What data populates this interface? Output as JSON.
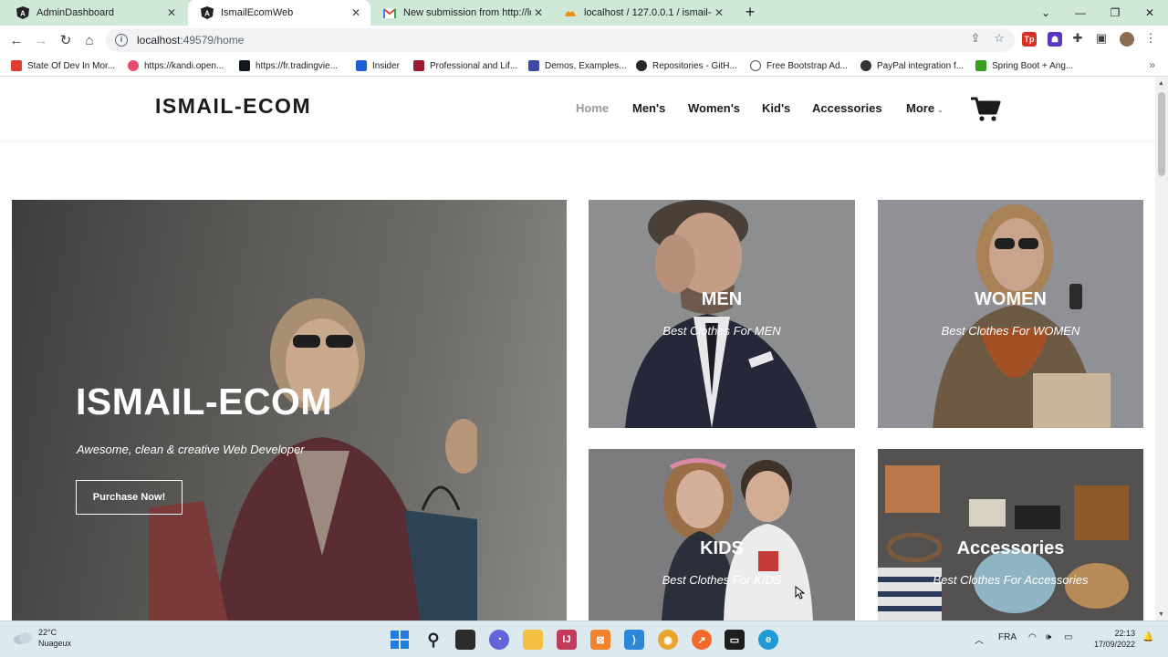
{
  "browser": {
    "tabs": [
      {
        "title": "AdminDashboard",
        "icon": "angular-icon",
        "active": false
      },
      {
        "title": "IsmailEcomWeb",
        "icon": "angular-icon",
        "active": true
      },
      {
        "title": "New submission from http://localhost",
        "icon": "gmail-icon",
        "active": false
      },
      {
        "title": "localhost / 127.0.0.1 / ismail-ecom",
        "icon": "phpmyadmin-icon",
        "active": false
      }
    ],
    "url_host": "localhost",
    "url_path": ":49579/home",
    "bookmarks": [
      {
        "label": "State Of Dev In Mor...",
        "color": "#e03b2f"
      },
      {
        "label": "https://kandi.open...",
        "color": "#e84c6b"
      },
      {
        "label": "https://fr.tradingvie...",
        "color": "#131722"
      },
      {
        "label": "Insider",
        "color": "#1d5fd6"
      },
      {
        "label": "Professional and Lif...",
        "color": "#9b1c2e"
      },
      {
        "label": "Demos, Examples...",
        "color": "#3b4aa6"
      },
      {
        "label": "Repositories - GitH...",
        "color": "#24292f"
      },
      {
        "label": "Free Bootstrap Ad...",
        "color": "#555555"
      },
      {
        "label": "PayPal integration f...",
        "color": "#333333"
      },
      {
        "label": "Spring Boot + Ang...",
        "color": "#3a9d23"
      }
    ]
  },
  "site": {
    "brand": "ISMAIL-ECOM",
    "menu": [
      {
        "label": "Home",
        "active": true
      },
      {
        "label": "Men's",
        "active": false
      },
      {
        "label": "Women's",
        "active": false
      },
      {
        "label": "Kid's",
        "active": false
      },
      {
        "label": "Accessories",
        "active": false
      },
      {
        "label": "More",
        "active": false
      }
    ],
    "hero": {
      "title": "ISMAIL-ECOM",
      "subtitle": "Awesome, clean & creative Web Developer",
      "button": "Purchase Now!"
    },
    "cards": [
      {
        "title": "MEN",
        "subtitle": "Best Clothes For MEN"
      },
      {
        "title": "WOMEN",
        "subtitle": "Best Clothes For WOMEN"
      },
      {
        "title": "KIDS",
        "subtitle": "Best Clothes For KIDS"
      },
      {
        "title": "Accessories",
        "subtitle": "Best Clothes For Accessories"
      }
    ]
  },
  "taskbar": {
    "temperature": "22°C",
    "weather": "Nuageux",
    "language": "FRA",
    "time": "22:13",
    "date": "17/09/2022"
  }
}
